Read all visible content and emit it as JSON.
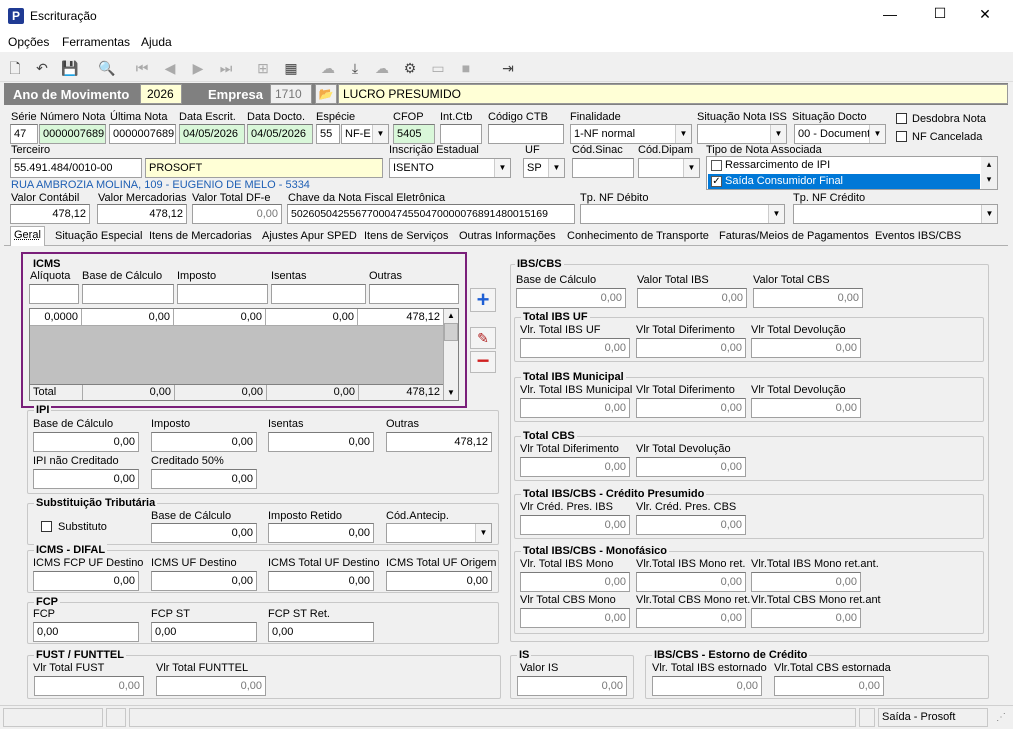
{
  "window": {
    "title": "Escrituração",
    "min": "—",
    "max": "☐",
    "close": "✕"
  },
  "menu": [
    "Opções",
    "Ferramentas",
    "Ajuda"
  ],
  "band": {
    "ano_label": "Ano de Movimento",
    "ano": "2026",
    "empresa_label": "Empresa",
    "empresa_code": "1710",
    "empresa_name": "LUCRO PRESUMIDO"
  },
  "labels": {
    "serie": "Série",
    "numero": "Número Nota",
    "ultima": "Última Nota",
    "data_escrit": "Data Escrit.",
    "data_docto": "Data Docto.",
    "especie": "Espécie",
    "cfop": "CFOP",
    "int_ctb": "Int.Ctb",
    "codigo_ctb": "Código CTB",
    "finalidade": "Finalidade",
    "sit_iss": "Situação Nota ISS",
    "sit_docto": "Situação Docto",
    "desdobra": "Desdobra Nota",
    "nf_cancelada": "NF Cancelada",
    "terceiro": "Terceiro",
    "insc_est": "Inscrição Estadual",
    "uf": "UF",
    "cod_sinac": "Cód.Sinac",
    "cod_dipam": "Cód.Dipam",
    "tipo_nota": "Tipo de Nota Associada",
    "valor_contabil": "Valor Contábil",
    "valor_merc": "Valor Mercadorias",
    "valor_df": "Valor Total DF-e",
    "chave": "Chave da Nota Fiscal Eletrônica",
    "tp_debito": "Tp. NF Débito",
    "tp_credito": "Tp. NF Crédito"
  },
  "fields": {
    "serie": "47",
    "numero": "0000007689",
    "ultima": "0000007689",
    "data_escrit": "04/05/2026",
    "data_docto": "04/05/2026",
    "especie_code": "55",
    "especie": "NF-E",
    "cfop": "5405",
    "finalidade": "1-NF normal",
    "sit_docto": "00 - Document",
    "terceiro_cnpj": "55.491.484/0010-00",
    "terceiro_nome": "PROSOFT",
    "insc_est": "ISENTO",
    "uf": "SP",
    "address": "RUA AMBROZIA MOLINA, 109 - EUGENIO DE MELO - 5334",
    "tipo_nota_items": [
      {
        "label": "Ressarcimento de IPI",
        "checked": false
      },
      {
        "label": "Saída Consumidor Final",
        "checked": true
      }
    ],
    "valor_contabil": "478,12",
    "valor_merc": "478,12",
    "valor_df": "0,00",
    "chave": "50260504255677000474550470000076891480015169"
  },
  "tabs": [
    "Geral",
    "Situação Especial",
    "Itens de Mercadorias",
    "Ajustes Apur SPED",
    "Itens de Serviços",
    "Outras Informações",
    "Conhecimento de Transporte",
    "Faturas/Meios de Pagamentos",
    "Eventos IBS/CBS"
  ],
  "icms": {
    "title": "ICMS",
    "headers": [
      "Alíquota",
      "Base de Cálculo",
      "Imposto",
      "Isentas",
      "Outras"
    ],
    "row": [
      "0,0000",
      "0,00",
      "0,00",
      "0,00",
      "478,12"
    ],
    "total": [
      "Total",
      "0,00",
      "0,00",
      "0,00",
      "478,12"
    ]
  },
  "ipi": {
    "title": "IPI",
    "base_label": "Base de Cálculo",
    "base": "0,00",
    "imposto_label": "Imposto",
    "imposto": "0,00",
    "isentas_label": "Isentas",
    "isentas": "0,00",
    "outras_label": "Outras",
    "outras": "478,12",
    "nao_cred_label": "IPI não Creditado",
    "nao_cred": "0,00",
    "cred50_label": "Creditado 50%",
    "cred50": "0,00"
  },
  "st": {
    "title": "Substituição Tributária",
    "substituto": "Substituto",
    "base_label": "Base de Cálculo",
    "base": "0,00",
    "retido_label": "Imposto Retido",
    "retido": "0,00",
    "antecip_label": "Cód.Antecip."
  },
  "difal": {
    "title": "ICMS - DIFAL",
    "l1": "ICMS FCP UF Destino",
    "v1": "0,00",
    "l2": "ICMS UF Destino",
    "v2": "0,00",
    "l3": "ICMS Total UF Destino",
    "v3": "0,00",
    "l4": "ICMS Total UF Origem",
    "v4": "0,00"
  },
  "fcp": {
    "title": "FCP",
    "l1": "FCP",
    "v1": "0,00",
    "l2": "FCP ST",
    "v2": "0,00",
    "l3": "FCP ST Ret.",
    "v3": "0,00"
  },
  "fust": {
    "title": "FUST / FUNTTEL",
    "l1": "Vlr Total FUST",
    "v1": "0,00",
    "l2": "Vlr Total FUNTTEL",
    "v2": "0,00"
  },
  "is": {
    "title": "IS",
    "l1": "Valor IS",
    "v1": "0,00"
  },
  "ibs": {
    "title": "IBS/CBS",
    "base_label": "Base de Cálculo",
    "base": "0,00",
    "total_ibs_label": "Valor Total IBS",
    "total_ibs": "0,00",
    "total_cbs_label": "Valor Total CBS",
    "total_cbs": "0,00",
    "uf_title": "Total IBS UF",
    "uf_l1": "Vlr. Total IBS UF",
    "uf_v1": "0,00",
    "uf_l2": "Vlr Total Diferimento",
    "uf_v2": "0,00",
    "uf_l3": "Vlr Total Devolução",
    "uf_v3": "0,00",
    "mun_title": "Total IBS Municipal",
    "mun_l1": "Vlr. Total IBS Municipal",
    "mun_v1": "0,00",
    "mun_l2": "Vlr Total Diferimento",
    "mun_v2": "0,00",
    "mun_l3": "Vlr Total Devolução",
    "mun_v3": "0,00",
    "cbs_title": "Total CBS",
    "cbs_l1": "Vlr Total Diferimento",
    "cbs_v1": "0,00",
    "cbs_l2": "Vlr Total Devolução",
    "cbs_v2": "0,00",
    "pres_title": "Total IBS/CBS - Crédito Presumido",
    "pres_l1": "Vlr Créd. Pres. IBS",
    "pres_v1": "0,00",
    "pres_l2": "Vlr. Créd. Pres. CBS",
    "pres_v2": "0,00",
    "mono_title": "Total IBS/CBS - Monofásico",
    "mono_l1": "Vlr. Total IBS Mono",
    "mono_v1": "0,00",
    "mono_l2": "Vlr.Total IBS Mono ret.",
    "mono_v2": "0,00",
    "mono_l3": "Vlr.Total IBS Mono ret.ant.",
    "mono_v3": "0,00",
    "mono_l4": "Vlr Total CBS Mono",
    "mono_v4": "0,00",
    "mono_l5": "Vlr.Total CBS Mono ret.",
    "mono_v5": "0,00",
    "mono_l6": "Vlr.Total CBS Mono ret.ant",
    "mono_v6": "0,00",
    "est_title": "IBS/CBS - Estorno de Crédito",
    "est_l1": "Vlr. Total IBS estornado",
    "est_v1": "0,00",
    "est_l2": "Vlr.Total CBS estornada",
    "est_v2": "0,00"
  },
  "status": {
    "text": "Saída - Prosoft"
  },
  "colors": {
    "band": "#808080",
    "highlight": "#0078d7",
    "accent_purple": "#7a1f7a",
    "green": "#d9f7d9",
    "yellow": "#ffffd6"
  }
}
